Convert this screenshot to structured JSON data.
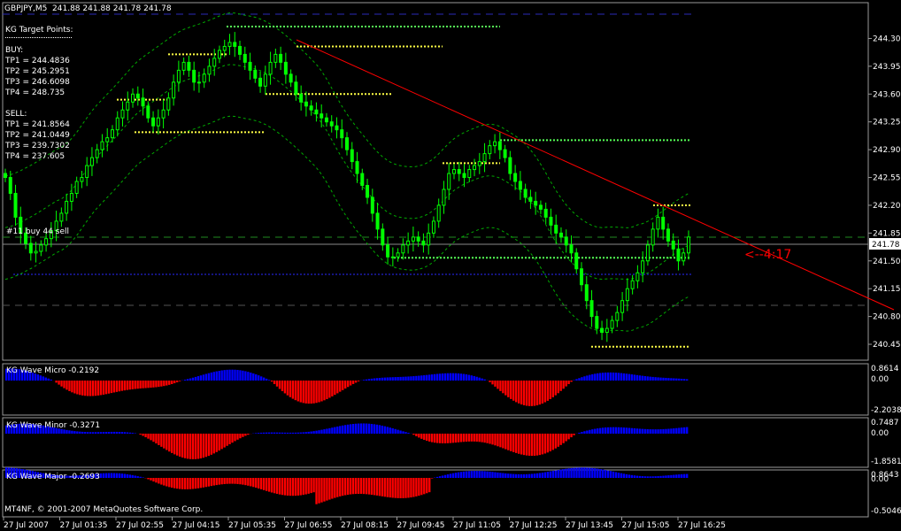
{
  "header": {
    "symbol_label": "GBPJPY,M5",
    "ohlc": "241.88 241.88 241.78 241.78"
  },
  "kg": {
    "title": "KG Target Points:",
    "buy_title": "BUY:",
    "buy": [
      "TP1 = 244.4836",
      "TP2 = 245.2951",
      "TP3 = 246.6098",
      "TP4 = 248.735"
    ],
    "sell_title": "SELL:",
    "sell": [
      "TP1 = 241.8564",
      "TP2 = 241.0449",
      "TP3 = 239.7302",
      "TP4 = 237.605"
    ]
  },
  "order_label": "#11 buy 44 sell",
  "timer": "<--4:17",
  "current_price": "241.78",
  "copyright": "MT4NF, © 2001-2007 MetaQuotes Software Corp.",
  "colors": {
    "background": "#000000",
    "bull": "#00ff00",
    "up_hist": "#0000ff",
    "down_hist": "#ff0000",
    "trend": "#ff0000",
    "timer": "#ff0000",
    "target_lines": "#ffff00",
    "band": "#00aa00"
  },
  "chart_data": [
    {
      "type": "candlestick",
      "title": "GBPJPY,M5",
      "ylim": [
        240.35,
        244.45
      ],
      "y_ticks": [
        "244.30",
        "243.95",
        "243.60",
        "243.25",
        "242.90",
        "242.55",
        "242.20",
        "241.85",
        "241.50",
        "241.15",
        "240.80",
        "240.45"
      ],
      "x_ticks": [
        "27 Jul 2007",
        "27 Jul 01:35",
        "27 Jul 02:55",
        "27 Jul 04:15",
        "27 Jul 05:35",
        "27 Jul 06:55",
        "27 Jul 08:15",
        "27 Jul 09:45",
        "27 Jul 11:05",
        "27 Jul 12:25",
        "27 Jul 13:45",
        "27 Jul 15:05",
        "27 Jul 16:25"
      ],
      "close": [
        242.55,
        242.35,
        242.05,
        241.85,
        241.72,
        241.6,
        241.62,
        241.7,
        241.78,
        241.88,
        242.0,
        242.1,
        242.25,
        242.35,
        242.5,
        242.55,
        242.7,
        242.8,
        242.9,
        243.0,
        243.05,
        243.15,
        243.3,
        243.4,
        243.5,
        243.6,
        243.55,
        243.45,
        243.3,
        243.2,
        243.3,
        243.4,
        243.55,
        243.75,
        243.9,
        244.0,
        243.9,
        243.75,
        243.75,
        243.85,
        243.95,
        244.05,
        244.15,
        244.2,
        244.25,
        244.2,
        244.1,
        244.0,
        243.9,
        243.8,
        243.7,
        243.85,
        244.0,
        244.1,
        244.0,
        243.85,
        243.75,
        243.6,
        243.5,
        243.45,
        243.4,
        243.35,
        243.3,
        243.25,
        243.2,
        243.15,
        243.05,
        242.9,
        242.75,
        242.6,
        242.45,
        242.3,
        242.1,
        241.9,
        241.7,
        241.55,
        241.55,
        241.6,
        241.7,
        241.75,
        241.8,
        241.75,
        241.7,
        241.85,
        242.0,
        242.2,
        242.4,
        242.6,
        242.65,
        242.6,
        242.55,
        242.65,
        242.7,
        242.75,
        242.85,
        242.95,
        243.0,
        242.9,
        242.8,
        242.6,
        242.5,
        242.4,
        242.3,
        242.25,
        242.2,
        242.15,
        242.05,
        241.95,
        241.85,
        241.8,
        241.7,
        241.6,
        241.4,
        241.2,
        241.0,
        240.8,
        240.65,
        240.6,
        240.65,
        240.75,
        240.85,
        241.0,
        241.15,
        241.25,
        241.35,
        241.5,
        241.7,
        241.9,
        242.05,
        241.9,
        241.75,
        241.65,
        241.5,
        241.6,
        241.8
      ]
    },
    {
      "type": "histogram",
      "title": "KG Wave Micro -0.2192",
      "y_ticks": [
        "0.8614",
        "0.00",
        "-2.2038"
      ]
    },
    {
      "type": "histogram",
      "title": "KG Wave Minor -0.3271",
      "y_ticks": [
        "0.7487",
        "0.00",
        "-1.8581"
      ]
    },
    {
      "type": "histogram",
      "title": "KG Wave Major -0.2693",
      "y_ticks": [
        "0.8643",
        "0.00",
        "-0.5046"
      ]
    }
  ]
}
